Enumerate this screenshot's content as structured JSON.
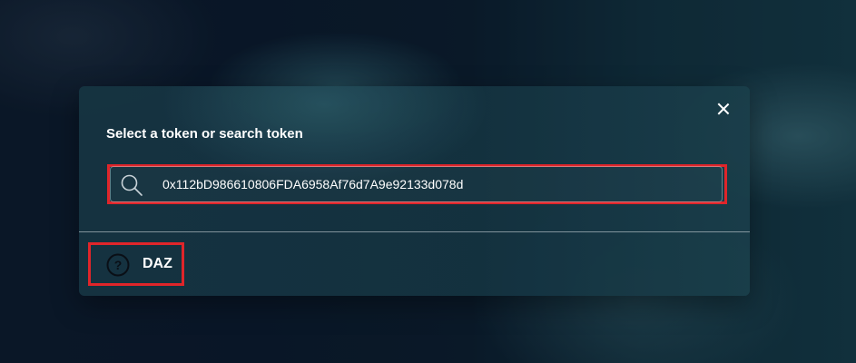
{
  "modal": {
    "title": "Select a token or search token",
    "close_icon": "close-icon",
    "search": {
      "icon": "search-icon",
      "value": "0x112bD986610806FDA6958Af76d7A9e92133d078d",
      "placeholder": ""
    },
    "tokens": [
      {
        "icon": "question-mark-icon",
        "symbol": "DAZ"
      }
    ]
  },
  "colors": {
    "highlight": "#e0252a",
    "modal_bg": "#163442",
    "text": "#ffffff"
  }
}
